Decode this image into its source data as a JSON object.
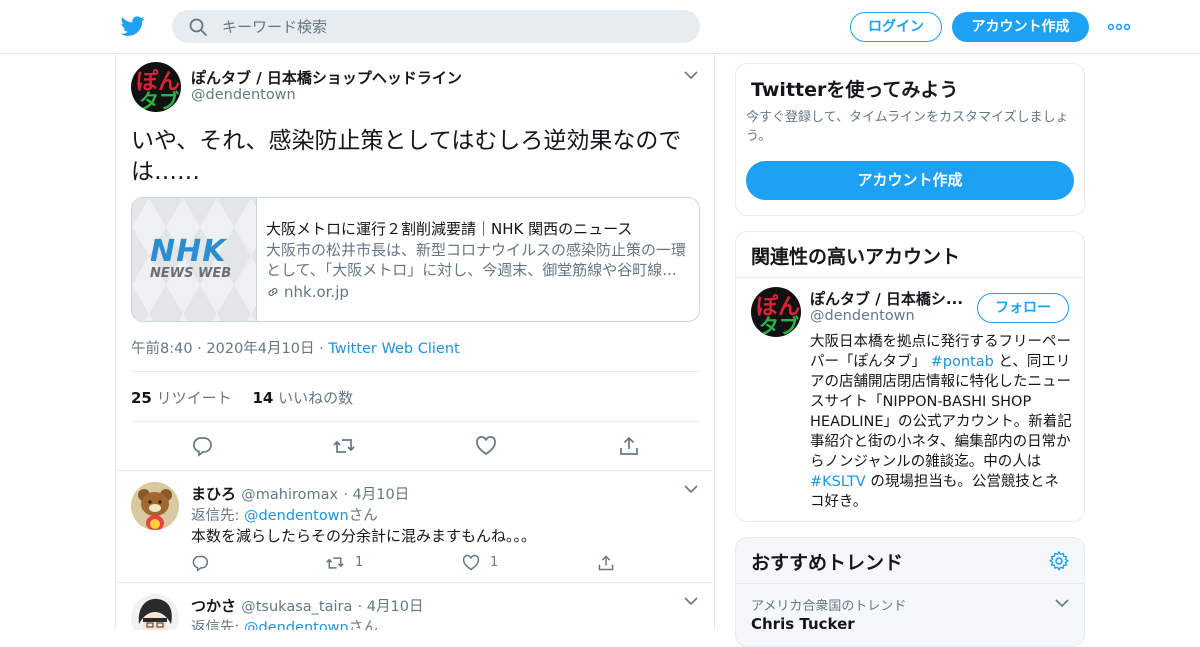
{
  "header": {
    "search_placeholder": "キーワード検索",
    "login_label": "ログイン",
    "signup_label": "アカウント作成"
  },
  "tweet": {
    "author_name": "ぽんタブ / 日本橋ショップヘッドライン",
    "author_handle": "@dendentown",
    "avatar_text_top": "ぽん",
    "avatar_text_bottom": "タブ",
    "text": "いや、それ、感染防止策としてはむしろ逆効果なのでは……",
    "card": {
      "logo": "NHK",
      "logo_sub": "NEWS WEB",
      "title": "大阪メトロに運行２割削減要請｜NHK 関西のニュース",
      "description": "大阪市の松井市長は、新型コロナウイルスの感染防止策の一環として、「大阪メトロ」に対し、今週末、御堂筋線や谷町線...",
      "domain": "nhk.or.jp"
    },
    "timestamp": "午前8:40 · 2020年4月10日",
    "separator": "·",
    "source": "Twitter Web Client",
    "retweet_count": "25",
    "retweet_label": "リツイート",
    "like_count": "14",
    "like_label": "いいねの数"
  },
  "replies": [
    {
      "name": "まひろ",
      "handle": "@mahiromax",
      "date": "· 4月10日",
      "reply_prefix": "返信先:",
      "reply_to": "@dendentown",
      "reply_suffix": "さん",
      "text": "本数を減らしたらその分余計に混みますもんね。。。",
      "retweets": "1",
      "likes": "1"
    },
    {
      "name": "つかさ",
      "handle": "@tsukasa_taira",
      "date": "· 4月10日",
      "reply_prefix": "返信先:",
      "reply_to": "@dendentown",
      "reply_suffix": "さん"
    }
  ],
  "sidebar": {
    "signup_box": {
      "title": "Twitterを使ってみよう",
      "description": "今すぐ登録して、タイムラインをカスタマイズしましょう。",
      "button": "アカウント作成"
    },
    "related": {
      "title": "関連性の高いアカウント",
      "name": "ぽんタブ / 日本橋シ...",
      "handle": "@dendentown",
      "follow_label": "フォロー",
      "bio_1": "大阪日本橋を拠点に発行するフリーペーパー「ぽんタブ」",
      "bio_tag_1": "#pontab",
      "bio_2": " と、同エリアの店舗開店閉店情報に特化したニュースサイト「NIPPON-BASHI SHOP HEADLINE」の公式アカウント。新着記事紹介と街の小ネタ、編集部内の日常からノンジャンルの雑談迄。中の人は ",
      "bio_tag_2": "#KSLTV",
      "bio_3": " の現場担当も。公営競技とネコ好き。"
    },
    "trends": {
      "title": "おすすめトレンド",
      "location_label": "アメリカ合衆国のトレンド",
      "first_trend": "Chris Tucker"
    }
  },
  "colors": {
    "accent": "#1da1f2",
    "link": "#1b95e0",
    "muted": "#657786"
  }
}
